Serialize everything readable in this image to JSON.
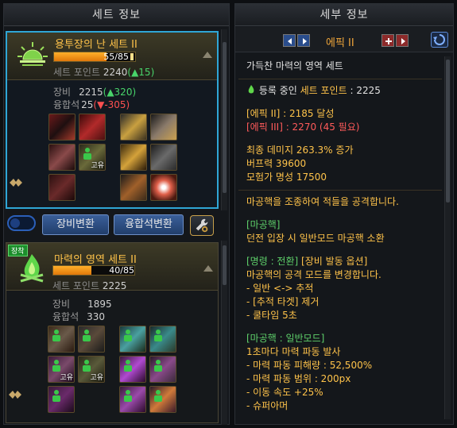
{
  "left_panel": {
    "title": "세트 정보",
    "set1": {
      "name": "용투장의 난 세트 II",
      "progress_text": "55/85",
      "progress_fraction": 0.647,
      "point_label": "세트 포인트",
      "point_value": "2240",
      "point_delta": "(▲15)",
      "equip_label": "장비",
      "equip_value": "2215",
      "equip_delta": "(▲320)",
      "fusion_label": "융합석",
      "fusion_value": "25",
      "fusion_delta": "(▼-305)",
      "slot_tag": "고유"
    },
    "toggle_label": "",
    "equip_switch_btn": "장비변환",
    "fusion_switch_btn": "융합석변환",
    "set2": {
      "badge": "장착",
      "name": "마력의 영역 세트 II",
      "progress_text": "40/85",
      "progress_fraction": 0.47,
      "point_label": "세트 포인트",
      "point_value": "2225",
      "equip_label": "장비",
      "equip_value": "1895",
      "fusion_label": "융합석",
      "fusion_value": "330",
      "slot_tag": "고유"
    }
  },
  "right_panel": {
    "title": "세부 정보",
    "tier": "에픽 II",
    "lines": {
      "set_title": "가득찬 마력의 영역 세트",
      "registered_prefix": "등록 중인 ",
      "registered_key": "세트 포인트",
      "registered_value": " : 2225",
      "epic2": "[에픽 II] : 2185 달성",
      "epic3": "[에픽 III] : 2270 (45 필요)",
      "final_damage": "최종 데미지 263.3% 증가",
      "buff_power": "버프력 39600",
      "adventurer_fame": "모험가 명성 17500",
      "desc": "마공핵을 조종하여 적들을 공격합니다.",
      "mgh_head": "[마공핵]",
      "mgh_body": "던전 입장 시 일반모드 마공핵 소환",
      "cmd_head_green": "[명령 : 전환]",
      "cmd_head_rest": " [장비 발동 옵션]",
      "cmd_body": "마공핵의 공격 모드를 변경합니다.",
      "cmd_opt1": "- 일반 <-> 추적",
      "cmd_opt2": "- [추적 타겟] 제거",
      "cmd_opt3": "- 쿨타임 5초",
      "normal_head": "[마공핵 : 일반모드]",
      "normal_body": "1초마다 마력 파동 발사",
      "normal_opt1": "- 마력 파동 피해량 : 52,500%",
      "normal_opt2": "- 마력 파동 범위 : 200px",
      "normal_opt3": "- 이동 속도 +25%",
      "normal_opt4": "- 슈퍼아머"
    }
  },
  "colors": {
    "accent_blue": "#2fa6d6",
    "gold": "#ffc34a",
    "green": "#48d46a",
    "red": "#ff5050"
  }
}
